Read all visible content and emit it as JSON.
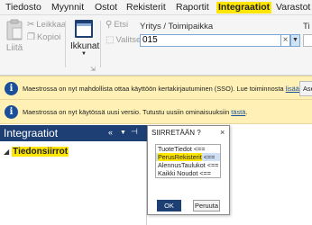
{
  "menu": {
    "items": [
      "Tiedosto",
      "Myynnit",
      "Ostot",
      "Rekisterit",
      "Raportit",
      "Integraatiot",
      "Varastot"
    ],
    "active": "Integraatiot"
  },
  "ribbon": {
    "liita": "Liitä",
    "leikkaa": "Leikkaa",
    "kopioi": "Kopioi",
    "ikkunat": "Ikkunat",
    "etsi": "Etsi",
    "valitse_kaikki": "Valitse kaikki",
    "company_label": "Yritys / Toimipaikka",
    "company_value": "015",
    "clear_symbol": "×",
    "right_label": "Ti"
  },
  "infobars": [
    {
      "text": "Maestrossa on nyt mahdollista ottaa käyttöön kertakirjautuminen (SSO). Lue toiminnosta ",
      "link": "lisää täältä",
      "after": ".",
      "button": "Ase"
    },
    {
      "text": "Maestrossa on nyt käytössä uusi versio. Tutustu uusiin ominaisuuksiin ",
      "link": "tästä",
      "after": "."
    }
  ],
  "panel": {
    "title": "Integraatiot",
    "tree_item": "Tiedonsiirrot"
  },
  "dialog": {
    "title": "SIIRRETÄÄN ?",
    "close": "×",
    "items": [
      {
        "name": "TuoteTiedot",
        "arrow": "<=="
      },
      {
        "name": "PerusRekisterit",
        "arrow": "<=="
      },
      {
        "name": "AlennusTaulukot",
        "arrow": "<=="
      },
      {
        "name": "Kaikki Noudot",
        "arrow": "<=="
      }
    ],
    "selected_index": 1,
    "ok": "OK",
    "cancel": "Peruuta"
  },
  "colors": {
    "accent_yellow": "#ffe600",
    "navy": "#1e3f73",
    "info_bg": "#fff1b5"
  }
}
